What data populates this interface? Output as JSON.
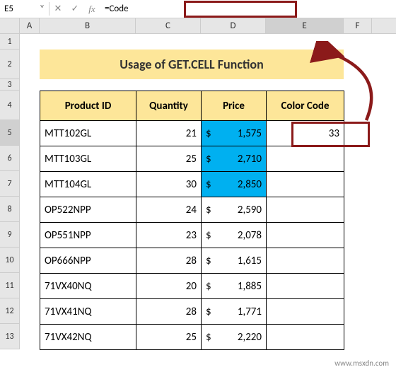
{
  "excel": {
    "name_box": "E5",
    "formula": "=Code",
    "columns": [
      "A",
      "B",
      "C",
      "D",
      "E",
      "F"
    ],
    "active_col": "E",
    "rows": [
      "1",
      "2",
      "3",
      "4",
      "5",
      "6",
      "7",
      "8",
      "9",
      "10",
      "11",
      "12",
      "13"
    ],
    "active_row": "5"
  },
  "title": "Usage of GET.CELL Function",
  "table": {
    "headers": {
      "pid": "Product ID",
      "qty": "Quantity",
      "prc": "Price",
      "cc": "Color Code"
    },
    "rows": [
      {
        "pid": "MTT102GL",
        "qty": "21",
        "cur": "$",
        "prc": "1,575",
        "hl": true,
        "cc": "33"
      },
      {
        "pid": "MTT103GL",
        "qty": "25",
        "cur": "$",
        "prc": "2,710",
        "hl": true,
        "cc": ""
      },
      {
        "pid": "MTT104GL",
        "qty": "30",
        "cur": "$",
        "prc": "2,850",
        "hl": true,
        "cc": ""
      },
      {
        "pid": "OP522NPP",
        "qty": "24",
        "cur": "$",
        "prc": "2,590",
        "hl": false,
        "cc": ""
      },
      {
        "pid": "OP551NPP",
        "qty": "23",
        "cur": "$",
        "prc": "2,078",
        "hl": false,
        "cc": ""
      },
      {
        "pid": "OP666NPP",
        "qty": "28",
        "cur": "$",
        "prc": "1,615",
        "hl": false,
        "cc": ""
      },
      {
        "pid": "71VX40NQ",
        "qty": "20",
        "cur": "$",
        "prc": "1,885",
        "hl": false,
        "cc": ""
      },
      {
        "pid": "71VX41NQ",
        "qty": "28",
        "cur": "$",
        "prc": "1,771",
        "hl": false,
        "cc": ""
      },
      {
        "pid": "71VX42NQ",
        "qty": "25",
        "cur": "$",
        "prc": "2,220",
        "hl": false,
        "cc": ""
      }
    ]
  },
  "watermark": "www.msxdn.com"
}
